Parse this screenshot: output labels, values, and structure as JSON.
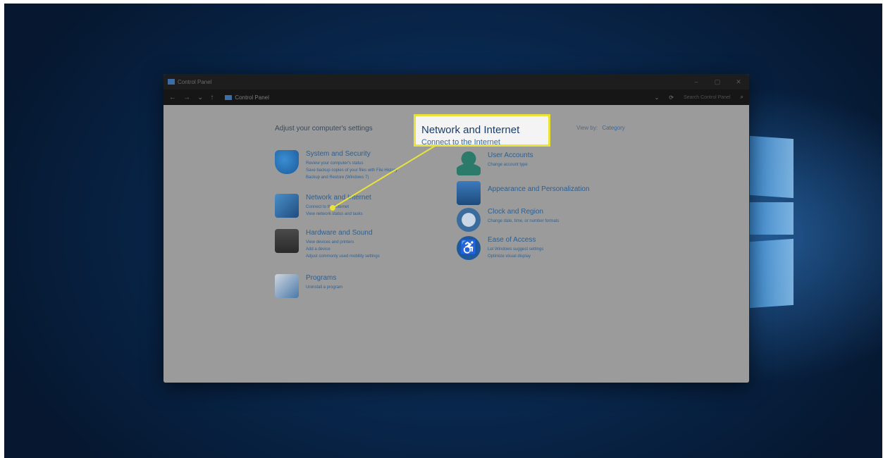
{
  "window": {
    "title": "Control Panel",
    "controls": [
      "–",
      "▢",
      "✕"
    ]
  },
  "address": {
    "nav": [
      "←",
      "→",
      "⌄",
      "↑"
    ],
    "path": "Control Panel",
    "search_placeholder": "Search Control Panel"
  },
  "content": {
    "heading": "Adjust your computer's settings",
    "view_by_label": "View by:",
    "view_by_value": "Category"
  },
  "categories": [
    {
      "title": "System and Security",
      "icon": "shield-icon",
      "links": [
        "Review your computer's status",
        "Save backup copies of your files with File History",
        "Backup and Restore (Windows 7)"
      ]
    },
    {
      "title": "Network and Internet",
      "icon": "network-icon",
      "links": [
        "Connect to the Internet",
        "View network status and tasks"
      ]
    },
    {
      "title": "Hardware and Sound",
      "icon": "printer-icon",
      "links": [
        "View devices and printers",
        "Add a device",
        "Adjust commonly used mobility settings"
      ]
    },
    {
      "title": "Programs",
      "icon": "programs-icon",
      "links": [
        "Uninstall a program"
      ]
    },
    {
      "title": "User Accounts",
      "icon": "user-icon",
      "links": [
        "Change account type"
      ]
    },
    {
      "title": "Appearance and Personalization",
      "icon": "appearance-icon",
      "links": []
    },
    {
      "title": "Clock and Region",
      "icon": "clock-icon",
      "links": [
        "Change date, time, or number formats"
      ]
    },
    {
      "title": "Ease of Access",
      "icon": "accessibility-icon",
      "links": [
        "Let Windows suggest settings",
        "Optimize visual display"
      ]
    }
  ],
  "callout": {
    "title": "Network and Internet",
    "subtitle": "Connect to the Internet",
    "highlight_color": "#e9e23a"
  }
}
